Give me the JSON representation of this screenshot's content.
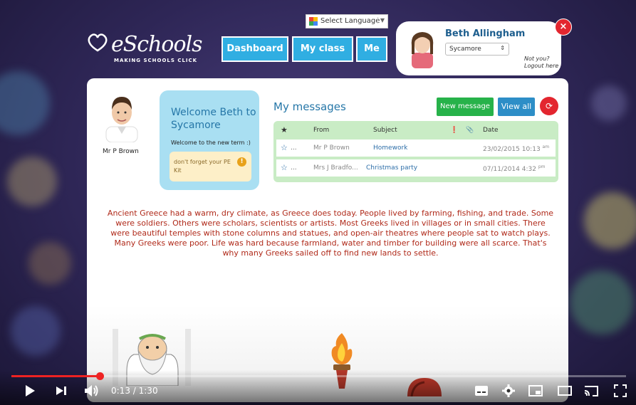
{
  "logo": {
    "name": "eSchools",
    "tagline": "MAKING SCHOOLS CLICK"
  },
  "language": {
    "label": "Select Language"
  },
  "nav": {
    "dashboard": "Dashboard",
    "myclass": "My class",
    "me": "Me"
  },
  "user": {
    "name": "Beth Allingham",
    "class_select": "Sycamore",
    "not_you": "Not you?",
    "logout": "Logout here"
  },
  "teacher": {
    "name": "Mr P Brown"
  },
  "welcome": {
    "title": "Welcome Beth to Sycamore",
    "subtitle": "Welcome to the new term :)",
    "note": "don't forget your PE Kit"
  },
  "messages": {
    "title": "My messages",
    "new_button": "New message",
    "view_all_button": "View all",
    "columns": {
      "from": "From",
      "subject": "Subject",
      "date": "Date"
    },
    "rows": [
      {
        "dots": "...",
        "from": "Mr P Brown",
        "subject": "Homework",
        "date": "23/02/2015 10:13",
        "ampm": "am"
      },
      {
        "dots": "...",
        "from": "Mrs J Bradfo...",
        "subject": "Christmas party",
        "date": "07/11/2014 4:32",
        "ampm": "pm"
      }
    ]
  },
  "story": "Ancient Greece had a warm, dry climate, as Greece does today. People lived by farming, fishing, and trade. Some were soldiers. Others were scholars, scientists or artists. Most Greeks lived in villages or in small cities. There were beautiful temples with stone columns and statues, and open-air theatres where people sat to watch plays. Many Greeks were poor. Life was hard because farmland, water and timber for building were all scarce. That's why many Greeks sailed off to find new lands to settle.",
  "player": {
    "current": "0:13",
    "separator": " / ",
    "duration": "1:30",
    "progress": 0.144
  },
  "colors": {
    "accent_blue": "#30aee2",
    "green": "#27b24a",
    "red": "#e3262f",
    "story_text": "#b02a1a"
  }
}
